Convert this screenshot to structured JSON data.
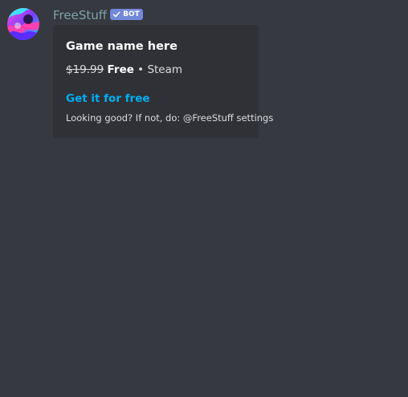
{
  "message": {
    "author": {
      "name": "FreeStuff",
      "tag": "BOT",
      "name_color": "#7ea1a7",
      "tag_color": "#7289da",
      "avatar_icon": "freestuff-logo-icon"
    },
    "embed": {
      "title": "Game name here",
      "original_price": "$19.99",
      "current_price": "Free",
      "separator": "•",
      "store": "Steam",
      "link_text": "Get it for free",
      "footer": "Looking good? If not, do: @FreeStuff settings",
      "link_color": "#00aff4",
      "background": "#2f3136"
    }
  },
  "theme": {
    "background": "#36393f"
  }
}
